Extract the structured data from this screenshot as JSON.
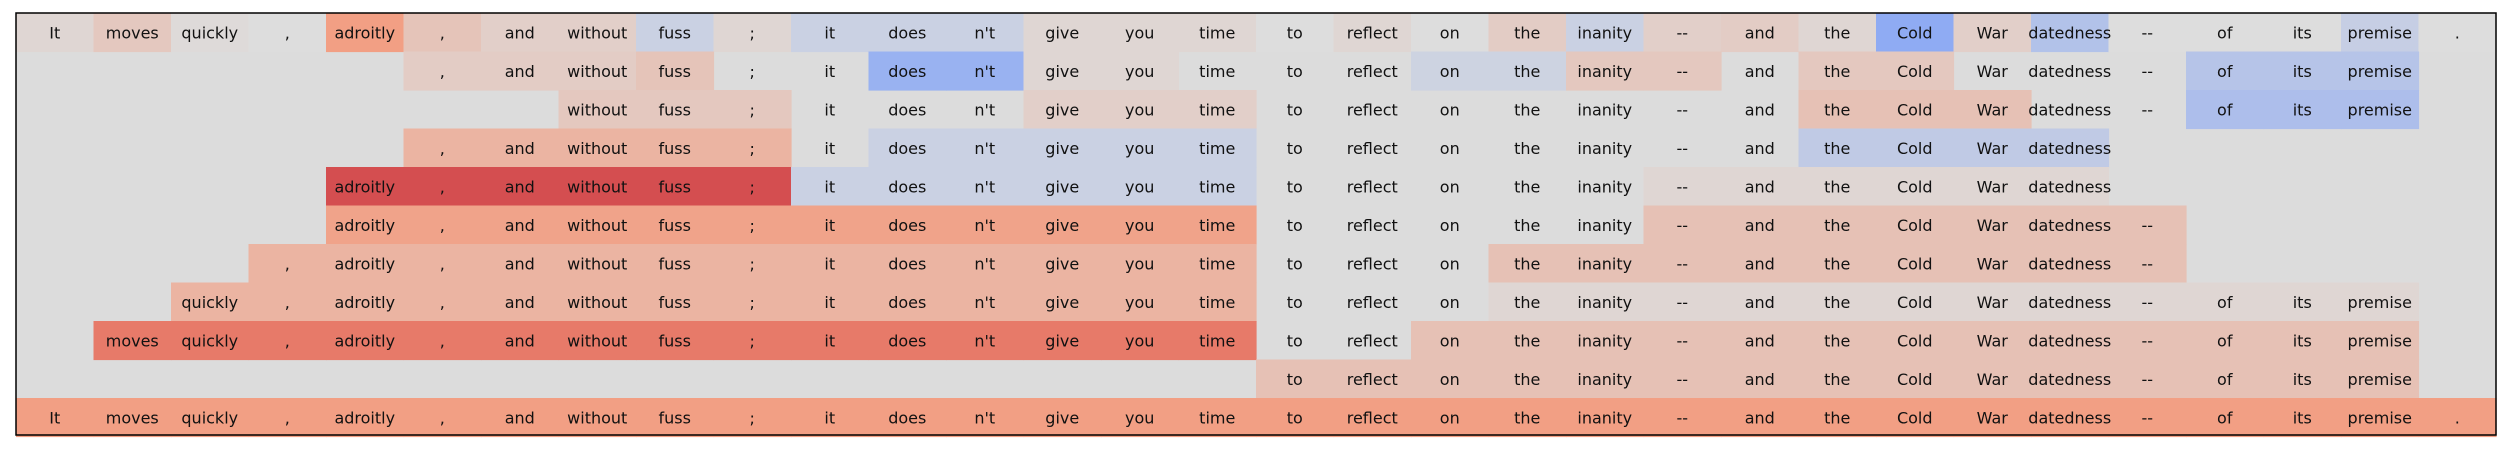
{
  "chart_data": {
    "type": "heatmap",
    "title": "",
    "xlabel": "",
    "ylabel": "",
    "tokens": [
      "It",
      "moves",
      "quickly",
      ",",
      "adroitly",
      ",",
      "and",
      "without",
      "fuss",
      ";",
      "it",
      "does",
      "n't",
      "give",
      "you",
      "time",
      "to",
      "reflect",
      "on",
      "the",
      "inanity",
      "--",
      "and",
      "the",
      "Cold",
      "War",
      "datedness",
      "--",
      "of",
      "its",
      "premise",
      "."
    ],
    "rows": [
      {
        "span": [
          0,
          31
        ],
        "values": [
          0.05,
          0.15,
          0.02,
          0.0,
          0.45,
          0.18,
          0.1,
          0.1,
          -0.1,
          0.05,
          -0.1,
          -0.1,
          -0.1,
          0.05,
          0.05,
          0.05,
          0.0,
          0.05,
          0.0,
          0.12,
          -0.1,
          0.1,
          0.12,
          0.05,
          -0.4,
          0.1,
          -0.22,
          0.0,
          0.0,
          0.0,
          -0.12,
          0.0
        ]
      },
      {
        "span": [
          5,
          30
        ],
        "values": [
          0.12,
          0.12,
          0.12,
          0.18,
          null,
          null,
          -0.35,
          -0.35,
          0.05,
          0.05,
          null,
          null,
          null,
          -0.08,
          -0.08,
          0.15,
          0.15,
          null,
          0.15,
          0.15,
          null,
          null,
          null,
          -0.2,
          -0.2,
          -0.2
        ]
      },
      {
        "span": [
          7,
          30
        ],
        "values": [
          0.15,
          0.15,
          0.15,
          null,
          null,
          null,
          0.1,
          0.1,
          0.1,
          null,
          null,
          null,
          null,
          null,
          null,
          null,
          0.2,
          0.2,
          0.2,
          null,
          null,
          -0.25,
          -0.25,
          -0.25
        ]
      },
      {
        "span": [
          5,
          26
        ],
        "values": [
          0.3,
          0.3,
          0.3,
          0.3,
          0.3,
          null,
          -0.1,
          -0.1,
          -0.1,
          -0.1,
          -0.1,
          null,
          null,
          null,
          null,
          null,
          null,
          null,
          -0.15,
          -0.15,
          -0.15,
          -0.15
        ]
      },
      {
        "span": [
          4,
          26
        ],
        "values": [
          0.75,
          0.75,
          0.75,
          0.75,
          0.75,
          0.75,
          -0.1,
          -0.1,
          -0.1,
          -0.1,
          -0.1,
          -0.1,
          null,
          null,
          null,
          null,
          null,
          0.05,
          0.05,
          0.05,
          0.05,
          0.05,
          0.05
        ]
      },
      {
        "span": [
          4,
          27
        ],
        "values": [
          0.42,
          0.42,
          0.42,
          0.42,
          0.42,
          0.42,
          0.42,
          0.42,
          0.42,
          0.42,
          0.42,
          0.42,
          null,
          null,
          null,
          null,
          null,
          0.2,
          0.2,
          0.2,
          0.2,
          0.2,
          0.2,
          0.2
        ]
      },
      {
        "span": [
          3,
          27
        ],
        "values": [
          0.3,
          0.3,
          0.3,
          0.3,
          0.3,
          0.3,
          0.3,
          0.3,
          0.3,
          0.3,
          0.3,
          0.3,
          0.3,
          null,
          null,
          null,
          0.2,
          0.2,
          0.2,
          0.2,
          0.2,
          0.2,
          0.2,
          0.2,
          0.2
        ]
      },
      {
        "span": [
          2,
          30
        ],
        "values": [
          0.3,
          0.3,
          0.3,
          0.3,
          0.3,
          0.3,
          0.3,
          0.3,
          0.3,
          0.3,
          0.3,
          0.3,
          0.3,
          0.3,
          null,
          null,
          null,
          0.05,
          0.05,
          0.05,
          0.05,
          0.05,
          0.05,
          0.05,
          0.05,
          0.05,
          0.05,
          0.05,
          0.05
        ]
      },
      {
        "span": [
          1,
          30
        ],
        "values": [
          0.6,
          0.6,
          0.6,
          0.6,
          0.6,
          0.6,
          0.6,
          0.6,
          0.6,
          0.6,
          0.6,
          0.6,
          0.6,
          0.6,
          0.6,
          null,
          null,
          0.2,
          0.2,
          0.2,
          0.2,
          0.2,
          0.2,
          0.2,
          0.2,
          0.2,
          0.2,
          0.2,
          0.2,
          0.2
        ]
      },
      {
        "span": [
          16,
          30
        ],
        "values": [
          0.2,
          0.2,
          0.2,
          0.2,
          0.2,
          0.2,
          0.2,
          0.2,
          0.2,
          0.2,
          0.2,
          0.2,
          0.2,
          0.2,
          0.2
        ]
      },
      {
        "span": [
          0,
          31
        ],
        "values": [
          0.45,
          0.45,
          0.45,
          0.45,
          0.45,
          0.45,
          0.45,
          0.45,
          0.45,
          0.45,
          0.45,
          0.45,
          0.45,
          0.45,
          0.45,
          0.45,
          0.45,
          0.45,
          0.45,
          0.45,
          0.45,
          0.45,
          0.45,
          0.45,
          0.45,
          0.45,
          0.45,
          0.45,
          0.45,
          0.45,
          0.45,
          0.45
        ]
      }
    ],
    "value_range": [
      -1,
      1
    ],
    "colormap": "coolwarm",
    "background_color": "#dcdcdc",
    "grid": false,
    "legend": "none"
  }
}
